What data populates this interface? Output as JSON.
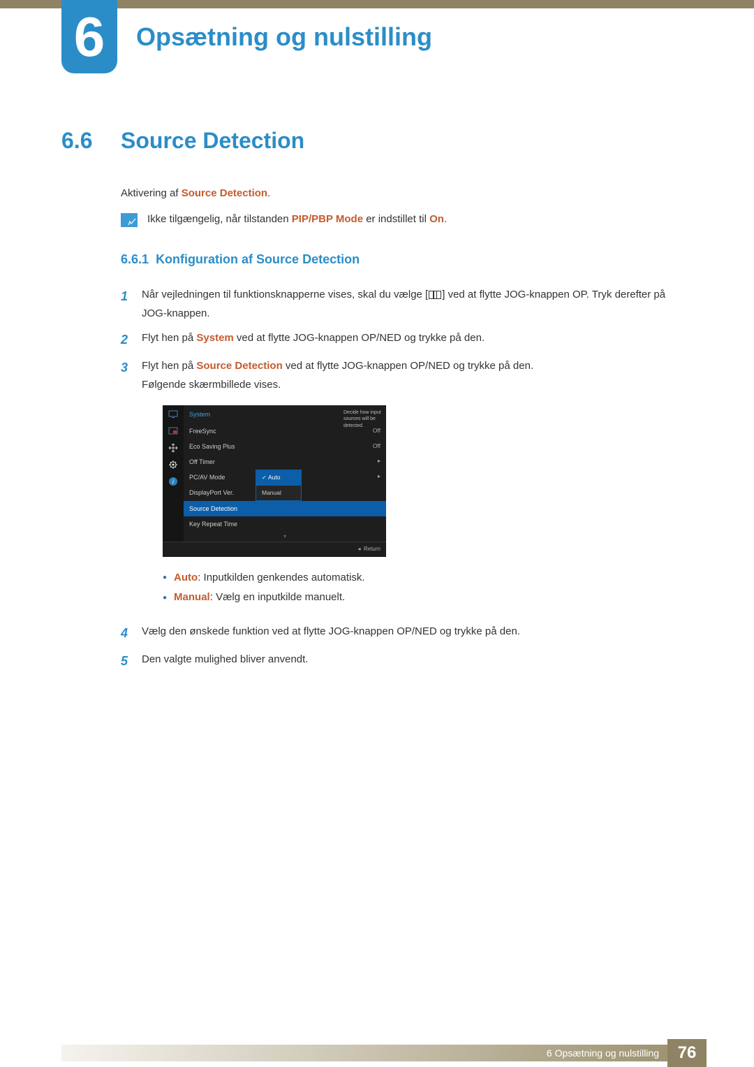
{
  "chapter": {
    "number": "6",
    "title": "Opsætning og nulstilling"
  },
  "section": {
    "number": "6.6",
    "title": "Source Detection"
  },
  "intro": {
    "prefix": "Aktivering af ",
    "emph": "Source Detection",
    "suffix": "."
  },
  "note": {
    "pre": "Ikke tilgængelig, når tilstanden ",
    "emph1": "PIP/PBP Mode",
    "mid": " er indstillet til ",
    "emph2": "On",
    "post": "."
  },
  "subsection": {
    "number": "6.6.1",
    "title": "Konfiguration af Source Detection"
  },
  "steps": {
    "s1": {
      "n": "1",
      "t1": "Når vejledningen til funktionsknapperne vises, skal du vælge [",
      "t2": "] ved at flytte JOG-knappen OP. Tryk derefter på JOG-knappen."
    },
    "s2": {
      "n": "2",
      "pre": "Flyt hen på ",
      "emph": "System",
      "post": " ved at flytte JOG-knappen OP/NED og trykke på den."
    },
    "s3": {
      "n": "3",
      "pre": "Flyt hen på ",
      "emph": "Source Detection",
      "post": " ved at flytte JOG-knappen OP/NED og trykke på den.",
      "line2": "Følgende skærmbillede vises."
    },
    "s4": {
      "n": "4",
      "text": "Vælg den ønskede funktion ved at flytte JOG-knappen OP/NED og trykke på den."
    },
    "s5": {
      "n": "5",
      "text": "Den valgte mulighed bliver anvendt."
    }
  },
  "osd": {
    "title": "System",
    "help": "Decide how input sources will be detected.",
    "rows": {
      "r1": {
        "label": "FreeSync",
        "value": "Off"
      },
      "r2": {
        "label": "Eco Saving Plus",
        "value": "Off"
      },
      "r3": {
        "label": "Off Timer",
        "arrow": "▸"
      },
      "r4": {
        "label": "PC/AV Mode",
        "arrow": "▸"
      },
      "r5": {
        "label": "DisplayPort Ver."
      },
      "r6": {
        "label": "Source Detection"
      },
      "r7": {
        "label": "Key Repeat Time"
      }
    },
    "popup": {
      "opt1": "Auto",
      "opt2": "Manual"
    },
    "return": "Return"
  },
  "bullets": {
    "b1": {
      "emph": "Auto",
      "text": ": Inputkilden genkendes automatisk."
    },
    "b2": {
      "emph": "Manual",
      "text": ": Vælg en inputkilde manuelt."
    }
  },
  "footer": {
    "text": "6 Opsætning og nulstilling",
    "page": "76"
  }
}
